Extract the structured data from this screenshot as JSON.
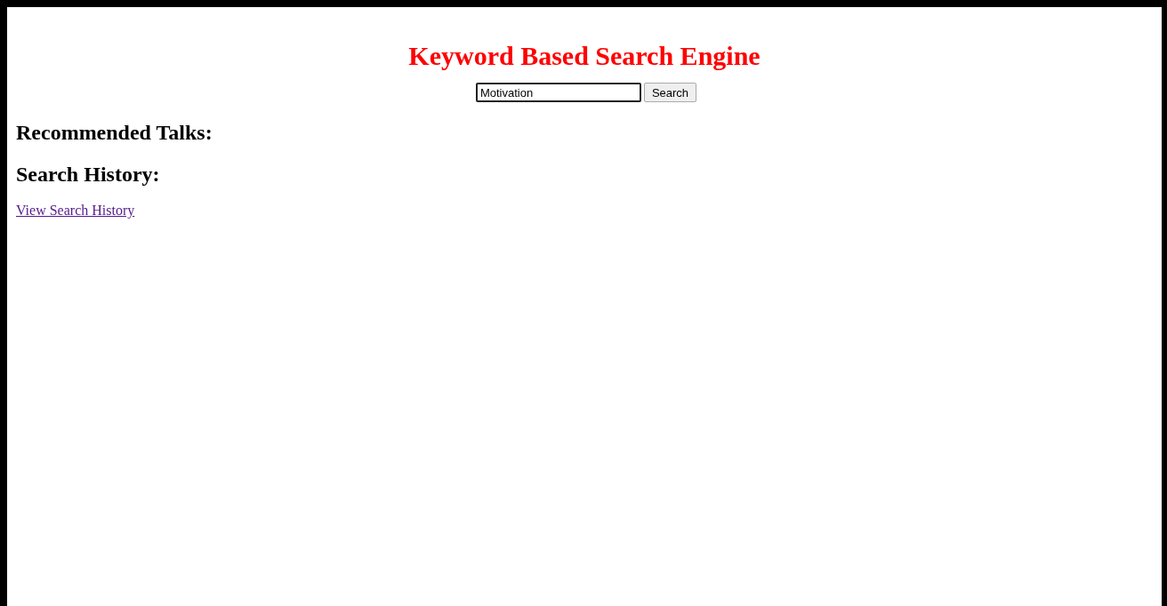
{
  "title": "Keyword Based Search Engine",
  "search": {
    "value": "Motivation",
    "button": "Search"
  },
  "sections": [
    {
      "heading": "Recommended Talks:"
    },
    {
      "heading": "Search History:"
    }
  ],
  "link": "View Search History"
}
